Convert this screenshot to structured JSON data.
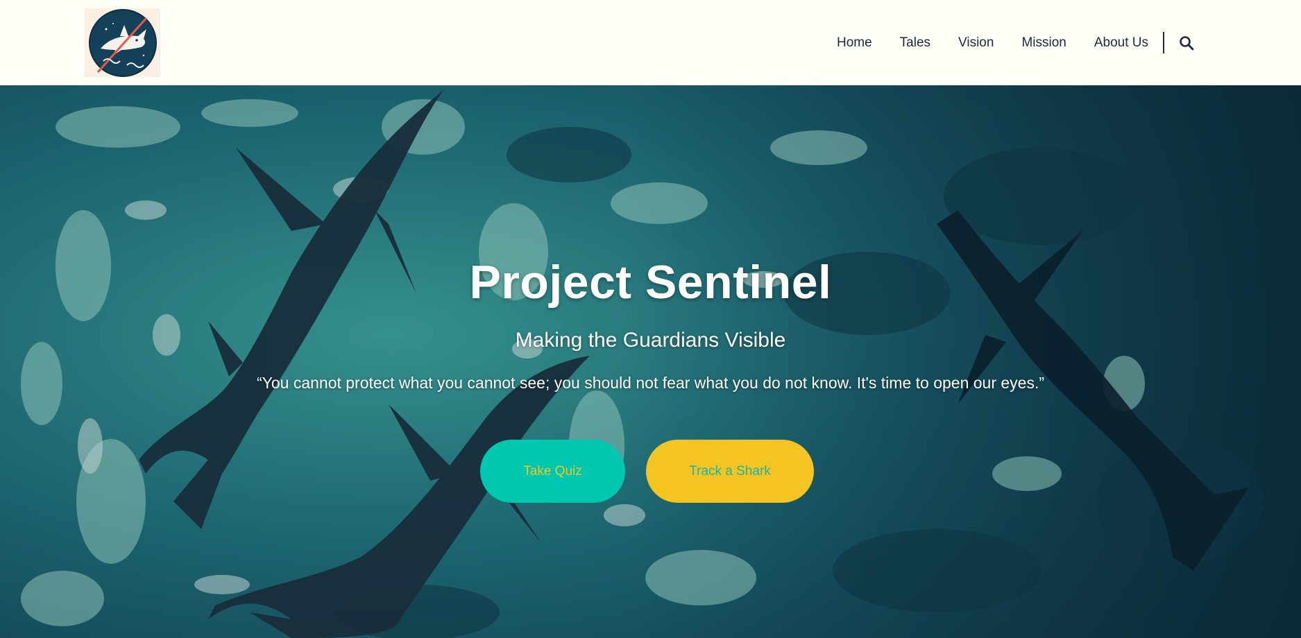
{
  "header": {
    "logo_icon": "shark-logo-icon",
    "nav": [
      {
        "label": "Home"
      },
      {
        "label": "Tales"
      },
      {
        "label": "Vision"
      },
      {
        "label": "Mission"
      },
      {
        "label": "About Us"
      }
    ],
    "search_icon": "search-icon"
  },
  "hero": {
    "title": "Project Sentinel",
    "subtitle": "Making the Guardians Visible",
    "quote": "“You cannot protect what you cannot see; you should not fear what you do not know. It's time to open our eyes.”",
    "buttons": {
      "quiz": "Take Quiz",
      "track": "Track a Shark"
    }
  },
  "colors": {
    "header_bg": "#fdfef5",
    "nav_text": "#1e2a3a",
    "quiz_button": "#00c8b0",
    "track_button": "#f4c422",
    "ocean_dark": "#123b4a",
    "ocean_light": "#3fa7a0"
  }
}
